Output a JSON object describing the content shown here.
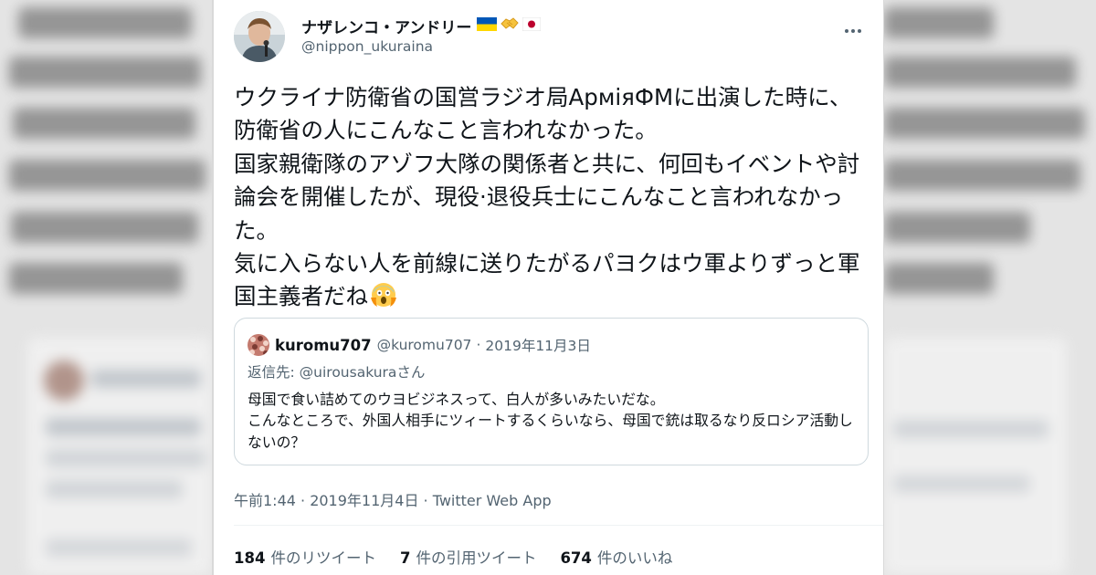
{
  "author": {
    "display_name": "ナザレンコ・アンドリー",
    "handle": "@nippon_ukuraina",
    "name_icons": [
      "ukraine-flag-icon",
      "handshake-icon",
      "japan-flag-icon"
    ]
  },
  "more_icon": "more-dots-icon",
  "tweet": {
    "text": "ウクライナ防衛省の国営ラジオ局АрміяФМに出演した時に、防衛省の人にこんなこと言われなかった。\n国家親衛隊のアゾフ大隊の関係者と共に、何回もイベントや討論会を開催したが、現役·退役兵士にこんなこと言われなかった。\n気に入らない人を前線に送りたがるパヨクはウ軍よりずっと軍国主義者だね",
    "trailing_icon": "scream-emoji-icon"
  },
  "quote": {
    "display_name": "kuromu707",
    "handle": "@kuromu707",
    "separator": "·",
    "date": "2019年11月3日",
    "reply_prefix": "返信先: ",
    "reply_to": "@uirousakura",
    "reply_suffix": "さん",
    "text": "母国で食い詰めてのウヨビジネスって、白人が多いみたいだな。\nこんなところで、外国人相手にツィートするくらいなら、母国で銃は取るなり反ロシア活動しないの？"
  },
  "timestamp": "午前1:44 · 2019年11月4日 · Twitter Web App",
  "stats": [
    {
      "count": "184",
      "label": "件のリツイート"
    },
    {
      "count": "7",
      "label": "件の引用ツイート"
    },
    {
      "count": "674",
      "label": "件のいいね"
    }
  ],
  "colors": {
    "text": "#0f1419",
    "secondary": "#536471",
    "border": "#cfd9de",
    "ukraine_blue": "#0057b7",
    "ukraine_yellow": "#ffd700",
    "japan_red": "#bc002d"
  }
}
